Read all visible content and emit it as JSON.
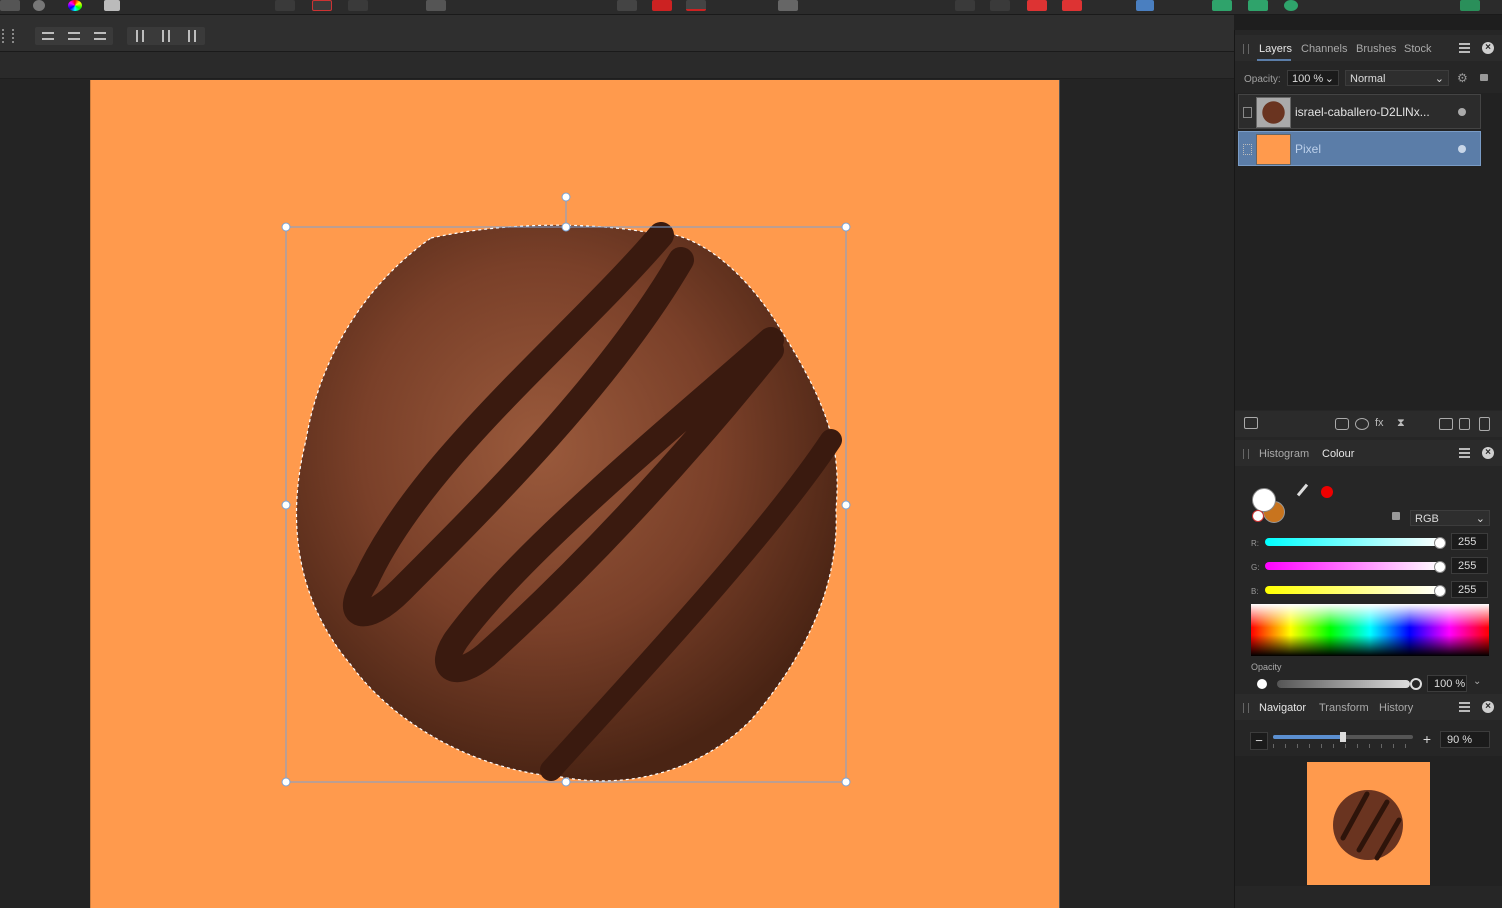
{
  "colors": {
    "canvas_bg": "#ff9a4d",
    "accent_blue": "#5b7da8",
    "selection_blue": "#7aa3d6"
  },
  "toolbar": {
    "icons": [
      "histogram-icon",
      "tone-icon",
      "colour-wheel-icon",
      "brush-icon",
      "marquee-icon",
      "crop-icon",
      "selection-icon",
      "quick-mask-icon",
      "insert-icon",
      "swatch-icon",
      "snapping-icon",
      "arrange-icon",
      "alignment-icon",
      "persona-icon"
    ]
  },
  "context_toolbar": {
    "icons": [
      "align-left-icon",
      "align-centre-icon",
      "align-right-icon",
      "align-top-icon",
      "align-middle-icon",
      "align-bottom-icon"
    ]
  },
  "layers_panel": {
    "tabs": [
      "Layers",
      "Channels",
      "Brushes",
      "Stock"
    ],
    "active_tab": "Layers",
    "opacity_label": "Opacity:",
    "opacity_value": "100 %",
    "blend_mode": "Normal",
    "layers": [
      {
        "name": "israel-caballero-D2LlNx...",
        "selected": false,
        "thumb": "macaron"
      },
      {
        "name": "Pixel",
        "selected": true,
        "thumb": "orange"
      }
    ]
  },
  "colour_panel": {
    "tabs": [
      "Histogram",
      "Colour"
    ],
    "active_tab": "Colour",
    "model": "RGB",
    "channels": [
      {
        "label": "R:",
        "value": "255",
        "gradient": "linear-gradient(to right,#00ffff,#ffffff)"
      },
      {
        "label": "G:",
        "value": "255",
        "gradient": "linear-gradient(to right,#ff00ff,#ffffff)"
      },
      {
        "label": "B:",
        "value": "255",
        "gradient": "linear-gradient(to right,#ffff00,#ffffff)"
      }
    ],
    "opacity_label": "Opacity",
    "opacity_value": "100 %"
  },
  "navigator_panel": {
    "tabs": [
      "Navigator",
      "Transform",
      "History"
    ],
    "active_tab": "Navigator",
    "zoom_value": "90 %"
  }
}
